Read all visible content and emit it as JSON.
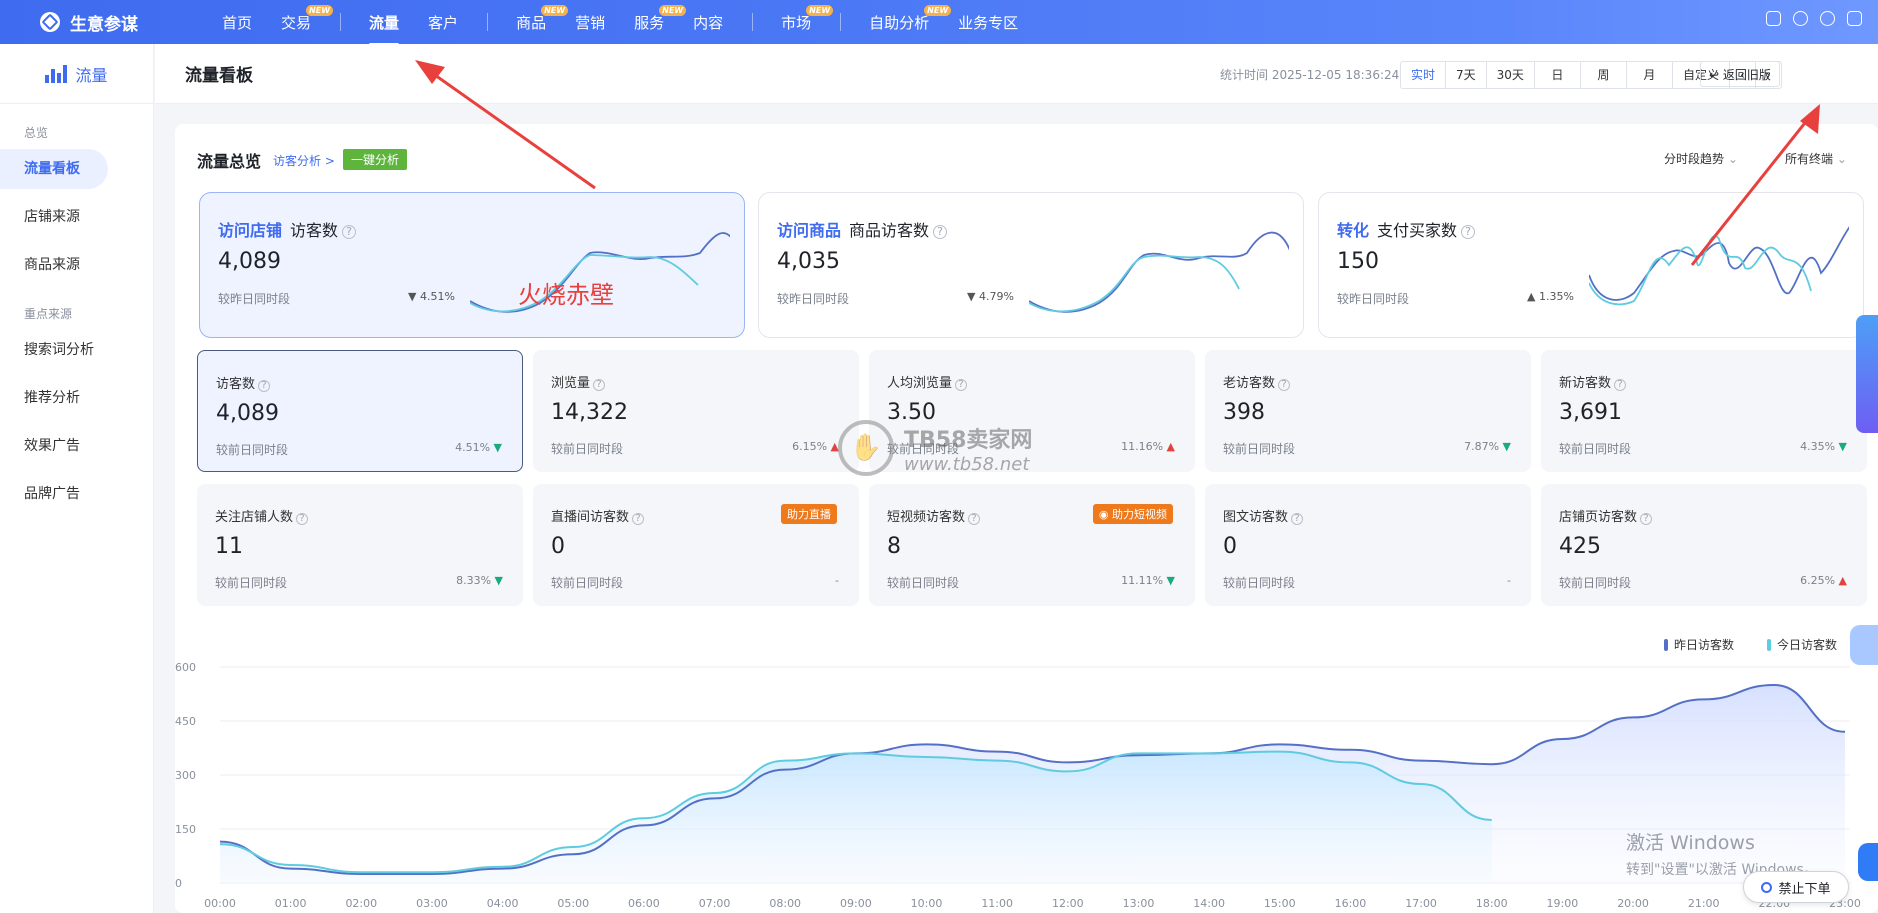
{
  "topnav": {
    "brand": "生意参谋",
    "items": [
      {
        "label": "首页",
        "new": false,
        "active": false
      },
      {
        "label": "交易",
        "new": true,
        "active": false
      },
      {
        "label": "流量",
        "new": false,
        "active": true
      },
      {
        "label": "客户",
        "new": false,
        "active": false
      },
      {
        "label": "商品",
        "new": true,
        "active": false
      },
      {
        "label": "营销",
        "new": false,
        "active": false
      },
      {
        "label": "服务",
        "new": true,
        "active": false
      },
      {
        "label": "内容",
        "new": false,
        "active": false
      },
      {
        "label": "市场",
        "new": true,
        "active": false
      },
      {
        "label": "自助分析",
        "new": true,
        "active": false
      },
      {
        "label": "业务专区",
        "new": false,
        "active": false
      }
    ],
    "new_badge": "NEW",
    "icons": [
      "message-icon",
      "user-icon",
      "help-icon",
      "logout-icon"
    ]
  },
  "sidebar": {
    "header": "流量",
    "groups": [
      {
        "label": "总览",
        "items": [
          {
            "label": "流量看板",
            "active": true
          },
          {
            "label": "店铺来源"
          },
          {
            "label": "商品来源"
          }
        ]
      },
      {
        "label": "重点来源",
        "items": [
          {
            "label": "搜索词分析"
          },
          {
            "label": "推荐分析"
          },
          {
            "label": "效果广告"
          },
          {
            "label": "品牌广告"
          }
        ]
      }
    ]
  },
  "subheader": {
    "title": "流量看板",
    "stat_time": "统计时间 2025-12-05 18:36:24",
    "time_buttons": [
      "实时",
      "7天",
      "30天",
      "日",
      "周",
      "月",
      "自定义"
    ],
    "active_time": "实时",
    "old_version": "返回旧版"
  },
  "overview": {
    "title": "流量总览",
    "visitor_link": "访客分析 >",
    "one_click": "一键分析",
    "select_trend": "分时段趋势",
    "select_terminal": "所有终端"
  },
  "big_cards": [
    {
      "category": "访问店铺",
      "metric": "访客数",
      "value": "4,089",
      "compare": "较昨日同时段",
      "pct": "4.51%",
      "dir": "down"
    },
    {
      "category": "访问商品",
      "metric": "商品访客数",
      "value": "4,035",
      "compare": "较昨日同时段",
      "pct": "4.79%",
      "dir": "down"
    },
    {
      "category": "转化",
      "metric": "支付买家数",
      "value": "150",
      "compare": "较昨日同时段",
      "pct": "1.35%",
      "dir": "up"
    }
  ],
  "metrics": [
    {
      "label": "访客数",
      "value": "4,089",
      "compare": "较前日同时段",
      "pct": "4.51%",
      "dir": "down"
    },
    {
      "label": "浏览量",
      "value": "14,322",
      "compare": "较前日同时段",
      "pct": "6.15%",
      "dir": "up"
    },
    {
      "label": "人均浏览量",
      "value": "3.50",
      "compare": "较前日同时段",
      "pct": "11.16%",
      "dir": "up"
    },
    {
      "label": "老访客数",
      "value": "398",
      "compare": "较前日同时段",
      "pct": "7.87%",
      "dir": "down"
    },
    {
      "label": "新访客数",
      "value": "3,691",
      "compare": "较前日同时段",
      "pct": "4.35%",
      "dir": "down"
    },
    {
      "label": "关注店铺人数",
      "value": "11",
      "compare": "较前日同时段",
      "pct": "8.33%",
      "dir": "down"
    },
    {
      "label": "直播间访客数",
      "value": "0",
      "compare": "较前日同时段",
      "pct": "-",
      "dir": "none",
      "badge": "助力直播"
    },
    {
      "label": "短视频访客数",
      "value": "8",
      "compare": "较前日同时段",
      "pct": "11.11%",
      "dir": "down",
      "badge": "助力短视频"
    },
    {
      "label": "图文访客数",
      "value": "0",
      "compare": "较前日同时段",
      "pct": "-",
      "dir": "none"
    },
    {
      "label": "店铺页访客数",
      "value": "425",
      "compare": "较前日同时段",
      "pct": "6.25%",
      "dir": "up"
    }
  ],
  "question_mark": "?",
  "colors": {
    "primary": "#3f6bf0",
    "yesterday": "#5470c6",
    "today": "#5fcbe0",
    "up": "#e0443e",
    "down": "#1aaa7c",
    "badge": "#ee7a1b"
  },
  "chart_data": {
    "type": "area",
    "x": [
      "00:00",
      "01:00",
      "02:00",
      "03:00",
      "04:00",
      "05:00",
      "06:00",
      "07:00",
      "08:00",
      "09:00",
      "10:00",
      "11:00",
      "12:00",
      "13:00",
      "14:00",
      "15:00",
      "16:00",
      "17:00",
      "18:00",
      "19:00",
      "20:00",
      "21:00",
      "22:00",
      "23:00"
    ],
    "ylim": [
      0,
      600
    ],
    "yticks": [
      0,
      150,
      300,
      450,
      600
    ],
    "series": [
      {
        "name": "昨日访客数",
        "values": [
          115,
          40,
          25,
          25,
          40,
          80,
          160,
          235,
          315,
          360,
          385,
          365,
          335,
          355,
          360,
          385,
          370,
          340,
          330,
          400,
          460,
          510,
          550,
          420
        ]
      },
      {
        "name": "今日访客数",
        "values": [
          108,
          50,
          30,
          30,
          45,
          100,
          180,
          250,
          340,
          360,
          350,
          340,
          310,
          360,
          360,
          365,
          335,
          275,
          175
        ]
      }
    ]
  },
  "watermark": {
    "name": "TB58卖家网",
    "url": "www.tb58.net"
  },
  "annotation_text": "火烧赤壁",
  "windows": {
    "line1": "激活 Windows",
    "line2": "转到\"设置\"以激活 Windows。"
  },
  "stop_order": "禁止下单"
}
